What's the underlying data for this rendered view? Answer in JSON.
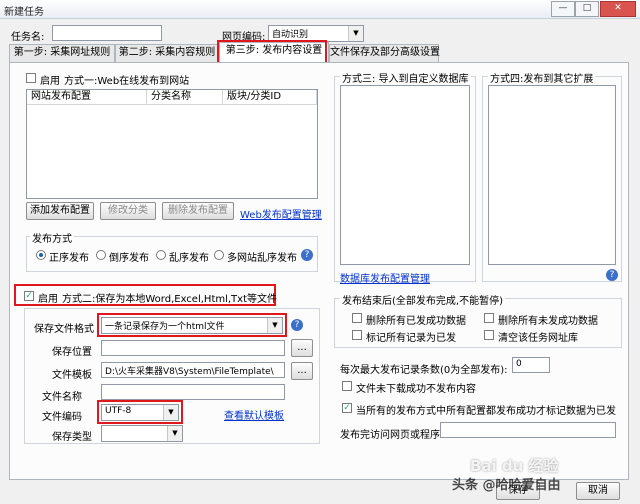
{
  "window": {
    "title": "新建任务",
    "min": "—",
    "max": "□",
    "close": "✕"
  },
  "header": {
    "task_name_label": "任务名:",
    "task_name_value": "",
    "encoding_label": "网页编码:",
    "encoding_value": "自动识别"
  },
  "tabs": [
    "第一步: 采集网址规则",
    "第二步: 采集内容规则",
    "第三步: 发布内容设置",
    "文件保存及部分高级设置"
  ],
  "web_publish": {
    "enable_label": "启用",
    "method_label": "方式一:Web在线发布到网站",
    "columns": [
      "网站发布配置",
      "分类名称",
      "版块/分类ID"
    ],
    "add_button": "添加发布配置",
    "edit_button": "修改分类",
    "delete_button": "删除发布配置",
    "manage_link": "Web发布配置管理"
  },
  "publish_mode": {
    "label": "发布方式",
    "options": [
      "正序发布",
      "倒序发布",
      "乱序发布",
      "多网站乱序发布"
    ],
    "selected": 0
  },
  "method3": {
    "label": "方式三: 导入到自定义数据库",
    "link": "数据库发布配置管理"
  },
  "method4": {
    "label": "方式四:发布到其它扩展"
  },
  "local_save": {
    "enable_label": "启用",
    "method_label": "方式二:保存为本地Word,Excel,Html,Txt等文件",
    "format_label": "保存文件格式",
    "format_value": "一条记录保存为一个html文件",
    "location_label": "保存位置",
    "location_value": "",
    "template_label": "文件模板",
    "template_value": "D:\\火车采集器V8\\System\\FileTemplate\\",
    "filename_label": "文件名称",
    "filename_value": "",
    "encoding_label": "文件编码",
    "encoding_value": "UTF-8",
    "default_template_link": "查看默认模板",
    "type_label": "保存类型",
    "type_value": "",
    "browse": "..."
  },
  "after_publish": {
    "label": "发布结束后(全部发布完成,不能暂停)",
    "options": [
      "删除所有已发成功数据",
      "删除所有未发成功数据",
      "标记所有记录为已发",
      "清空该任务网址库"
    ]
  },
  "settings": {
    "max_records_label": "每次最大发布记录条数(0为全部发布):",
    "max_records_value": "0",
    "no_download_label": "文件未下载成功不发布内容",
    "mark_label": "当所有的发布方式中所有配置都发布成功才标记数据为已发",
    "visit_label": "发布完访问网页或程序",
    "visit_value": ""
  },
  "footer": {
    "save_button": "保存",
    "cancel_button": "取消"
  },
  "watermark": {
    "baidu": "Bai du 经验",
    "author": "头条 @哈哈爱自由"
  },
  "colors": {
    "highlight": "#e0181e",
    "link": "#0033cc",
    "accent": "#1a5fb4"
  }
}
